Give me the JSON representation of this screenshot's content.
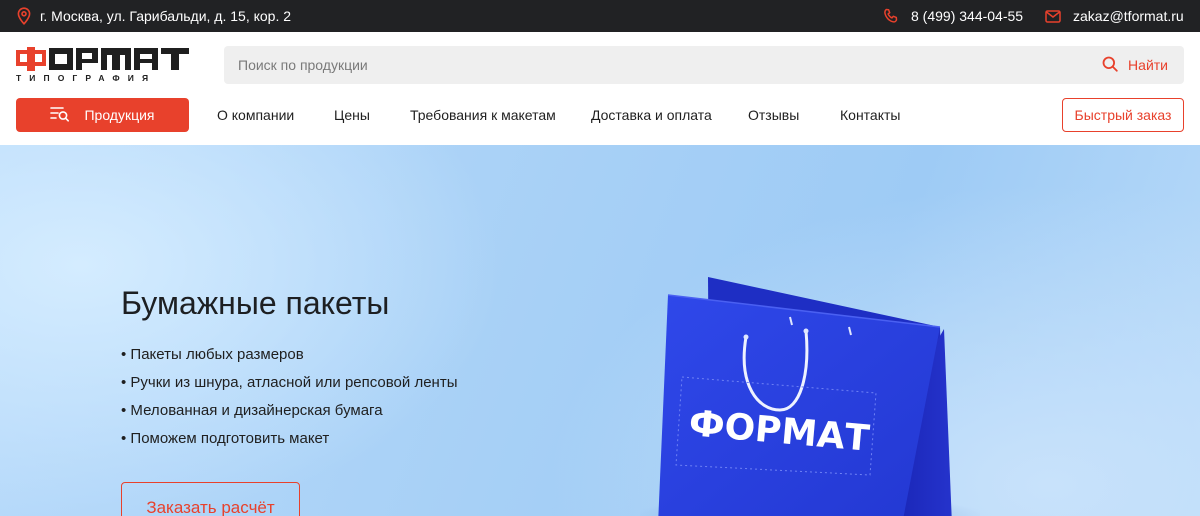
{
  "topbar": {
    "address": "г. Москва, ул. Гарибальди, д. 15, кор. 2",
    "phone": "8 (499) 344-04-55",
    "email": "zakaz@tformat.ru"
  },
  "logo": {
    "word": "ФОРМАТ",
    "sub": "ТИПОГРАФИЯ"
  },
  "search": {
    "placeholder": "Поиск по продукции",
    "button_label": "Найти"
  },
  "nav": {
    "products_label": "Продукция",
    "items": [
      "О компании",
      "Цены",
      "Требования к макетам",
      "Доставка и оплата",
      "Отзывы",
      "Контакты"
    ],
    "quick_order_label": "Быстрый заказ"
  },
  "hero": {
    "title": "Бумажные пакеты",
    "bullets": [
      "Пакеты любых размеров",
      "Ручки из шнура, атласной или репсовой ленты",
      "Мелованная и дизайнерская бумага",
      "Поможем подготовить макет"
    ],
    "button_label": "Заказать расчёт",
    "bag_print": "ФОРМАТ"
  },
  "colors": {
    "accent": "#e8412c",
    "topbar_bg": "#212224",
    "bag_blue": "#2a3fe0"
  },
  "icons": {
    "address": "map-pin-icon",
    "phone": "phone-icon",
    "email": "envelope-icon",
    "search": "search-icon",
    "products": "catalog-search-icon"
  }
}
